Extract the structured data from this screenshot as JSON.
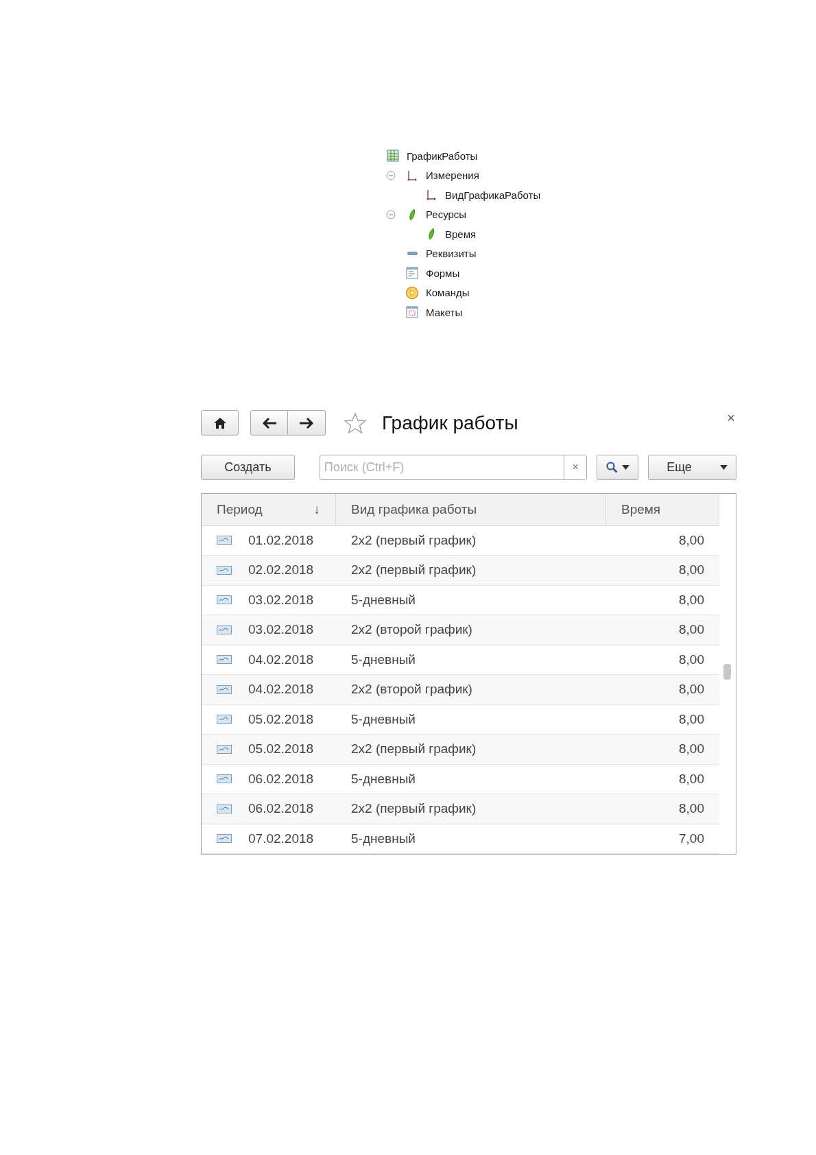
{
  "tree": [
    {
      "label": "ГрафикРаботы",
      "kind": "register",
      "children": [
        {
          "label": "Измерения",
          "kind": "dimension",
          "expanded": true,
          "children": [
            {
              "label": "ВидГрафикаРаботы",
              "kind": "dimension"
            }
          ]
        },
        {
          "label": "Ресурсы",
          "kind": "resource",
          "expanded": true,
          "children": [
            {
              "label": "Время",
              "kind": "resource"
            }
          ]
        },
        {
          "label": "Реквизиты",
          "kind": "attribute"
        },
        {
          "label": "Формы",
          "kind": "form"
        },
        {
          "label": "Команды",
          "kind": "command"
        },
        {
          "label": "Макеты",
          "kind": "template"
        }
      ]
    }
  ],
  "window": {
    "title": "График работы",
    "close": "×"
  },
  "toolbar": {
    "create": "Создать",
    "search": {
      "placeholder": "Поиск (Ctrl+F)",
      "clear": "×"
    },
    "more": "Еще"
  },
  "table": {
    "columns": [
      {
        "label": "Период",
        "sort": "↓"
      },
      {
        "label": "Вид графика работы"
      },
      {
        "label": "Время"
      }
    ],
    "rows": [
      {
        "period": "01.02.2018",
        "schedule": "2x2 (первый график)",
        "time": "8,00"
      },
      {
        "period": "02.02.2018",
        "schedule": "2x2 (первый график)",
        "time": "8,00"
      },
      {
        "period": "03.02.2018",
        "schedule": "5-дневный",
        "time": "8,00"
      },
      {
        "period": "03.02.2018",
        "schedule": "2x2 (второй график)",
        "time": "8,00"
      },
      {
        "period": "04.02.2018",
        "schedule": "5-дневный",
        "time": "8,00"
      },
      {
        "period": "04.02.2018",
        "schedule": "2x2 (второй график)",
        "time": "8,00"
      },
      {
        "period": "05.02.2018",
        "schedule": "5-дневный",
        "time": "8,00"
      },
      {
        "period": "05.02.2018",
        "schedule": "2x2 (первый график)",
        "time": "8,00"
      },
      {
        "period": "06.02.2018",
        "schedule": "5-дневный",
        "time": "8,00"
      },
      {
        "period": "06.02.2018",
        "schedule": "2x2 (первый график)",
        "time": "8,00"
      },
      {
        "period": "07.02.2018",
        "schedule": "5-дневный",
        "time": "7,00"
      }
    ]
  }
}
